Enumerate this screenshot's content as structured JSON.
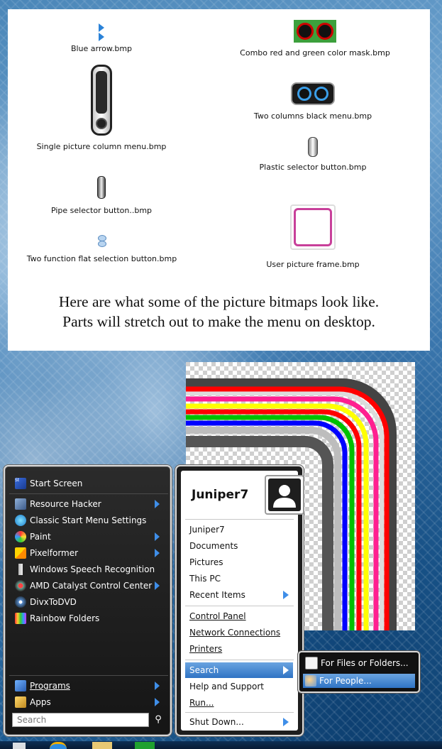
{
  "card": {
    "items": {
      "blue_arrow": "Blue arrow.bmp",
      "combo_mask": "Combo red and green color mask.bmp",
      "single_column": "Single picture column menu.bmp",
      "two_columns": "Two columns black menu.bmp",
      "plastic_selector": "Plastic selector button.bmp",
      "pipe_selector": "Pipe selector button..bmp",
      "flat_selection": "Two function flat selection button.bmp",
      "user_frame": "User picture frame.bmp"
    },
    "note_line1": "Here are what some of the picture bitmaps look like.",
    "note_line2": "Parts will stretch out to make the menu on desktop."
  },
  "left_menu": {
    "start_screen": "Start Screen",
    "items": [
      {
        "label": "Resource Hacker",
        "icon": "resource-hacker-icon"
      },
      {
        "label": "Classic Start Menu Settings",
        "icon": "classic-start-icon"
      },
      {
        "label": "Paint",
        "icon": "paint-icon"
      },
      {
        "label": "Pixelformer",
        "icon": "pixelformer-icon"
      },
      {
        "label": "Windows Speech Recognition",
        "icon": "microphone-icon"
      },
      {
        "label": "AMD Catalyst Control Center",
        "icon": "amd-icon"
      },
      {
        "label": "DivxToDVD",
        "icon": "divx-icon"
      },
      {
        "label": "Rainbow Folders",
        "icon": "rainbow-folders-icon"
      }
    ],
    "programs": "Programs",
    "apps": "Apps",
    "search_placeholder": "Search"
  },
  "right_menu": {
    "username": "Juniper7",
    "group1": [
      "Juniper7",
      "Documents",
      "Pictures",
      "This PC",
      "Recent Items"
    ],
    "group2": [
      "Control Panel",
      "Network Connections",
      "Printers"
    ],
    "group3": [
      "Search",
      "Help and Support",
      "Run..."
    ],
    "shutdown": "Shut Down..."
  },
  "submenu": {
    "files": "For Files or Folders...",
    "people": "For People..."
  },
  "colors": {
    "accent": "#3f8ee8",
    "selection": "#2f73c4",
    "rainbow": [
      "#ff0000",
      "#ffff00",
      "#00c000",
      "#0000ff",
      "#ff00ff",
      "#ff0000"
    ]
  }
}
